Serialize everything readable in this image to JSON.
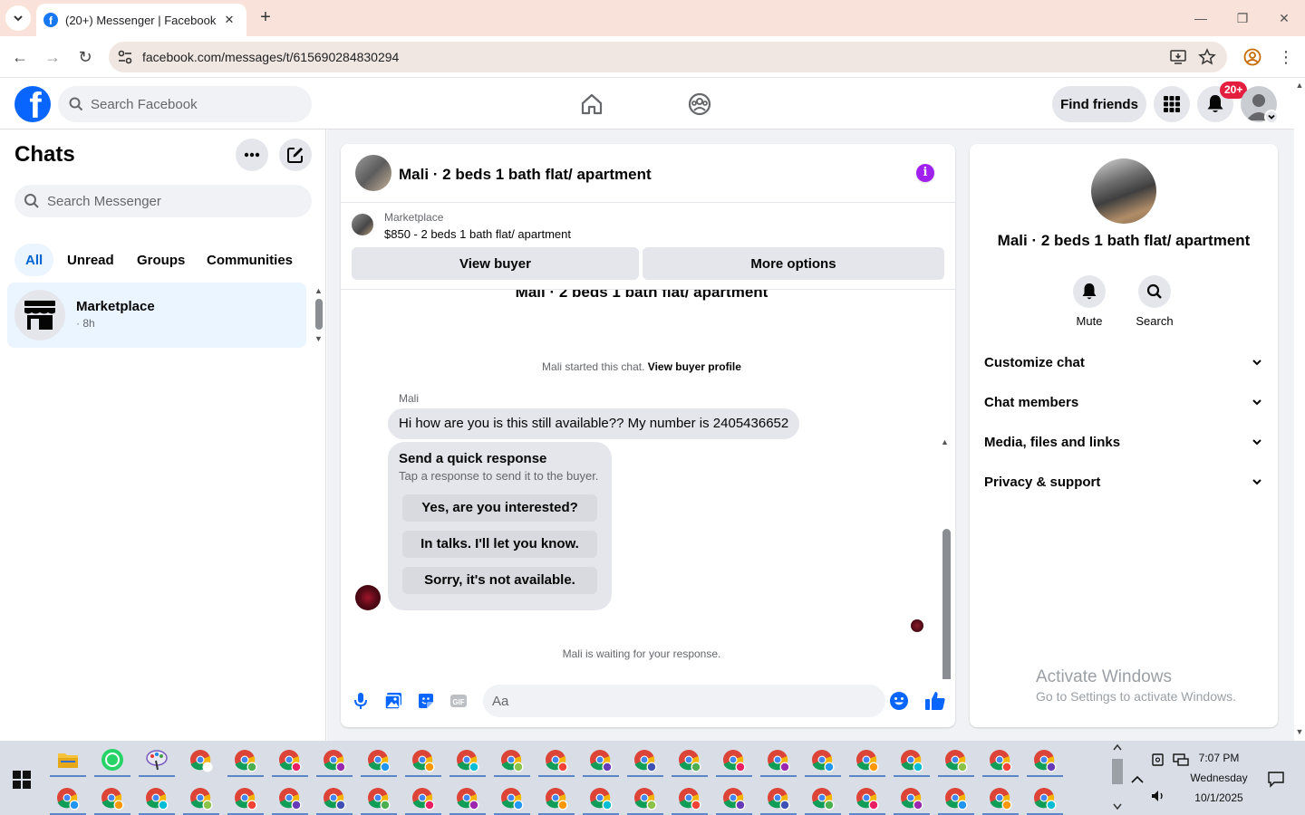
{
  "browser": {
    "tab_title": "(20+) Messenger | Facebook",
    "url": "facebook.com/messages/t/615690284830294"
  },
  "facebook": {
    "search_placeholder": "Search Facebook",
    "find_friends": "Find friends",
    "notification_badge": "20+"
  },
  "sidebar": {
    "title": "Chats",
    "search_placeholder": "Search Messenger",
    "filters": [
      "All",
      "Unread",
      "Groups",
      "Communities"
    ],
    "active_filter": "All",
    "chats": [
      {
        "name": "Marketplace",
        "time": "· 8h"
      }
    ]
  },
  "conversation": {
    "title": "Mali · 2 beds 1 bath flat/ apartment",
    "marketplace_label": "Marketplace",
    "listing": "$850 - 2 beds 1 bath flat/ apartment",
    "view_buyer": "View buyer",
    "more_options": "More options",
    "started_text": "Mali started this chat.",
    "view_buyer_profile": "View buyer profile",
    "sender": "Mali",
    "message": "Hi how are you is this still available?? My number is 2405436652",
    "quick_title": "Send a quick response",
    "quick_subtitle": "Tap a response to send it to the buyer.",
    "quick_responses": [
      "Yes, are you interested?",
      "In talks. I'll let you know.",
      "Sorry, it's not available."
    ],
    "waiting_text": "Mali is waiting for your response.",
    "composer_placeholder": "Aa"
  },
  "info_panel": {
    "name": "Mali · 2 beds 1 bath flat/ apartment",
    "actions": [
      "Mute",
      "Search"
    ],
    "sections": [
      "Customize chat",
      "Chat members",
      "Media, files and links",
      "Privacy & support"
    ]
  },
  "watermark": {
    "line1": "Activate Windows",
    "line2": "Go to Settings to activate Windows."
  },
  "taskbar": {
    "time": "7:07 PM",
    "day": "Wednesday",
    "date": "10/1/2025"
  },
  "colors": {
    "facebook_blue": "#0866ff",
    "active_filter_bg": "#ebf5ff",
    "info_purple": "#a020f0",
    "notification_red": "#e41e3f"
  }
}
